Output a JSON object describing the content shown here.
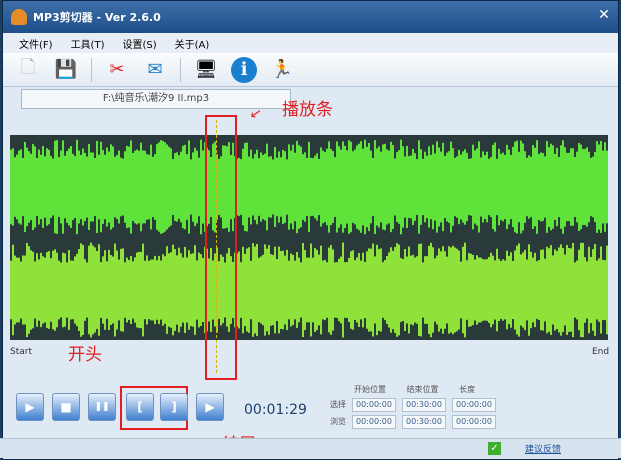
{
  "window": {
    "title": "MP3剪切器 - Ver 2.6.0",
    "close": "✕"
  },
  "menu": [
    "文件(F)",
    "工具(T)",
    "设置(S)",
    "关于(A)"
  ],
  "toolbar": [
    {
      "icon": "new-file-icon",
      "glyph": "🗋"
    },
    {
      "icon": "save-icon",
      "glyph": "💾"
    },
    {
      "icon": "scissors-icon",
      "glyph": "✂"
    },
    {
      "icon": "mail-icon",
      "glyph": "✉"
    },
    {
      "icon": "monitor-icon",
      "glyph": "🖥"
    },
    {
      "icon": "info-icon",
      "glyph": "ℹ"
    },
    {
      "icon": "person-icon",
      "glyph": "🏃"
    }
  ],
  "file_tab": "F:\\纯音乐\\潮汐9 II.mp3",
  "waveform": {
    "start": "Start",
    "end": "End",
    "color": "#5fe23a"
  },
  "annotations": {
    "playbar": "播放条",
    "start": "开头",
    "end": "结尾"
  },
  "controls": [
    {
      "name": "play",
      "glyph": "▶"
    },
    {
      "name": "stop",
      "glyph": "■"
    },
    {
      "name": "pause",
      "glyph": "❚❚"
    },
    {
      "name": "set-start",
      "glyph": "["
    },
    {
      "name": "set-end",
      "glyph": "]"
    },
    {
      "name": "play-selection",
      "glyph": "▶"
    }
  ],
  "time": "00:01:29",
  "positions": {
    "headers": [
      "开始位置",
      "结束位置",
      "长度"
    ],
    "rows": [
      {
        "label": "选择",
        "values": [
          "00:00:00",
          "00:30:00",
          "00:00:00"
        ]
      },
      {
        "label": "浏览",
        "values": [
          "00:00:00",
          "00:30:00",
          "00:00:00"
        ]
      }
    ]
  },
  "status": {
    "feedback": "建议反馈"
  }
}
